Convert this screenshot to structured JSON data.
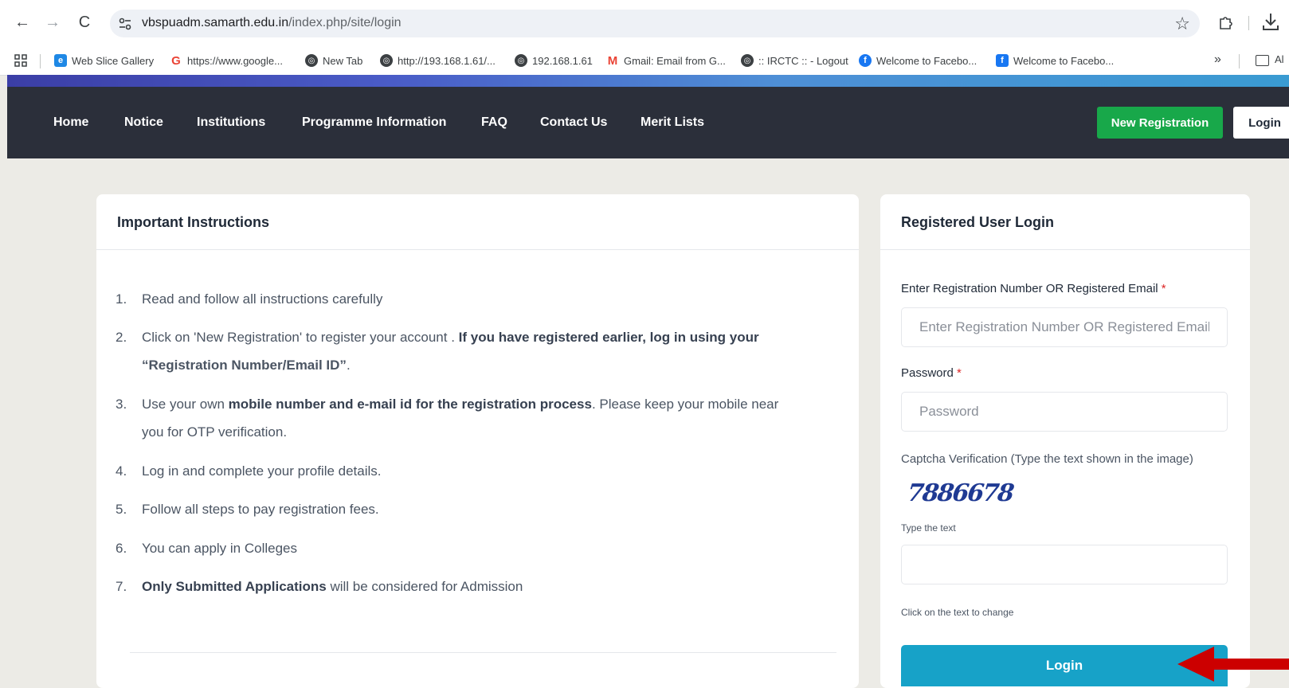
{
  "browser": {
    "url_host": "vbspuadm.samarth.edu.in",
    "url_path": "/index.php/site/login",
    "bookmarks": [
      {
        "label": "Web Slice Gallery",
        "icon": "web-slice-icon",
        "color": "#1e88e5"
      },
      {
        "label": "https://www.google...",
        "icon": "google-icon",
        "color": "#ea4335"
      },
      {
        "label": "New Tab",
        "icon": "globe-icon",
        "color": "#3c4043"
      },
      {
        "label": "http://193.168.1.61/...",
        "icon": "globe-icon",
        "color": "#3c4043"
      },
      {
        "label": "192.168.1.61",
        "icon": "globe-icon",
        "color": "#3c4043"
      },
      {
        "label": "Gmail: Email from G...",
        "icon": "gmail-icon",
        "color": "#ea4335"
      },
      {
        "label": ":: IRCTC :: - Logout",
        "icon": "globe-icon",
        "color": "#3c4043"
      },
      {
        "label": "Welcome to Facebo...",
        "icon": "facebook-icon",
        "color": "#1877f2"
      },
      {
        "label": "Welcome to Facebo...",
        "icon": "facebook-square-icon",
        "color": "#1877f2"
      }
    ],
    "more": "»",
    "all_bookmarks": "Al"
  },
  "site_nav": {
    "links": [
      "Home",
      "Notice",
      "Institutions",
      "Programme Information",
      "FAQ",
      "Contact Us",
      "Merit Lists"
    ],
    "new_registration": "New Registration",
    "login": "Login",
    "bg_color": "#2b2f3a",
    "accent_green": "#18a84a"
  },
  "instructions": {
    "title": "Important Instructions",
    "items": [
      {
        "num": "1.",
        "pre": "Read and follow all instructions carefully",
        "bold": "",
        "post": ""
      },
      {
        "num": "2.",
        "pre": "Click on 'New Registration' to register your account . ",
        "bold": "If you have registered earlier, log in using your",
        "post": ""
      },
      {
        "num": "3.",
        "pre": "Use your own ",
        "bold": "mobile number and e-mail id for the registration process",
        "post": ". Please keep your mobile near"
      },
      {
        "num": "4.",
        "pre": "Log in and complete your profile details.",
        "bold": "",
        "post": ""
      },
      {
        "num": "5.",
        "pre": "Follow all steps to pay registration fees.",
        "bold": "",
        "post": ""
      },
      {
        "num": "6.",
        "pre": "You can apply in Colleges",
        "bold": "",
        "post": ""
      },
      {
        "num": "7.",
        "pre": "",
        "bold": "Only Submitted Applications",
        "post": " will be considered for Admission"
      }
    ],
    "item2_cont_bold": "“Registration Number/Email ID”",
    "item2_cont_post": ".",
    "item3_cont": "you for OTP verification."
  },
  "login_form": {
    "title": "Registered User Login",
    "username_label": "Enter Registration Number OR Registered Email",
    "username_placeholder": "Enter Registration Number OR Registered Email",
    "username_value": "",
    "password_label": "Password",
    "password_placeholder": "Password",
    "password_value": "",
    "required_mark": "*",
    "captcha_label": "Captcha Verification (Type the text shown in the image)",
    "captcha_text": "7886678",
    "type_text_label": "Type the text",
    "captcha_value": "",
    "captcha_hint": "Click on the text to change",
    "login_button": "Login",
    "button_color": "#17a2c8"
  }
}
